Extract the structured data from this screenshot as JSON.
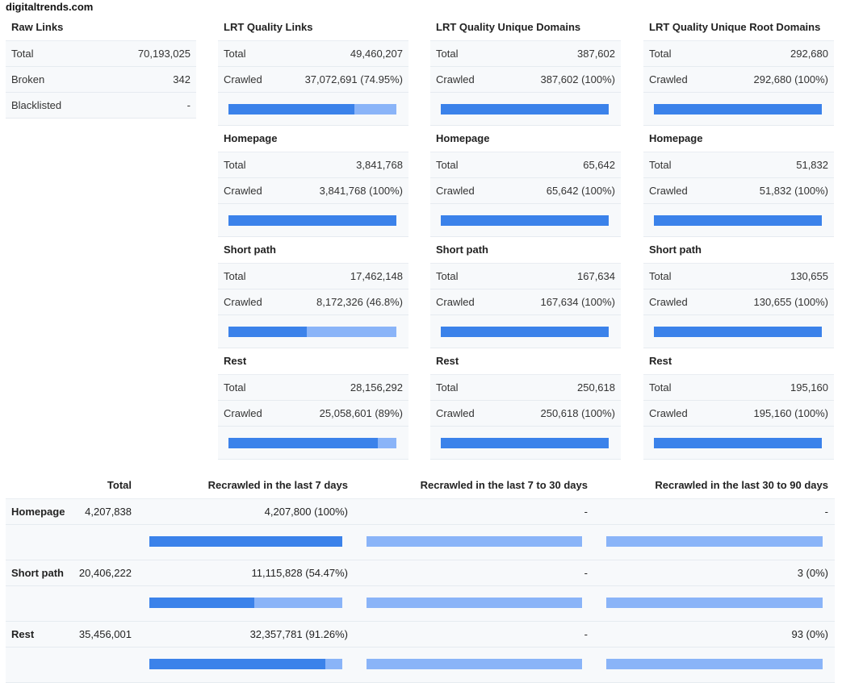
{
  "site": "digitaltrends.com",
  "raw_links": {
    "title": "Raw Links",
    "rows": [
      {
        "label": "Total",
        "value": "70,193,025"
      },
      {
        "label": "Broken",
        "value": "342"
      },
      {
        "label": "Blacklisted",
        "value": "-"
      }
    ]
  },
  "columns": [
    {
      "title": "LRT Quality Links",
      "sections": [
        {
          "title": "",
          "total_label": "Total",
          "total": "49,460,207",
          "crawled_label": "Crawled",
          "crawled": "37,072,691 (74.95%)",
          "fraction": 0.7495
        },
        {
          "title": "Homepage",
          "total_label": "Total",
          "total": "3,841,768",
          "crawled_label": "Crawled",
          "crawled": "3,841,768 (100%)",
          "fraction": 1.0
        },
        {
          "title": "Short path",
          "total_label": "Total",
          "total": "17,462,148",
          "crawled_label": "Crawled",
          "crawled": "8,172,326 (46.8%)",
          "fraction": 0.468
        },
        {
          "title": "Rest",
          "total_label": "Total",
          "total": "28,156,292",
          "crawled_label": "Crawled",
          "crawled": "25,058,601 (89%)",
          "fraction": 0.89
        }
      ]
    },
    {
      "title": "LRT Quality Unique Domains",
      "sections": [
        {
          "title": "",
          "total_label": "Total",
          "total": "387,602",
          "crawled_label": "Crawled",
          "crawled": "387,602 (100%)",
          "fraction": 1.0
        },
        {
          "title": "Homepage",
          "total_label": "Total",
          "total": "65,642",
          "crawled_label": "Crawled",
          "crawled": "65,642 (100%)",
          "fraction": 1.0
        },
        {
          "title": "Short path",
          "total_label": "Total",
          "total": "167,634",
          "crawled_label": "Crawled",
          "crawled": "167,634 (100%)",
          "fraction": 1.0
        },
        {
          "title": "Rest",
          "total_label": "Total",
          "total": "250,618",
          "crawled_label": "Crawled",
          "crawled": "250,618 (100%)",
          "fraction": 1.0
        }
      ]
    },
    {
      "title": "LRT Quality Unique Root Domains",
      "sections": [
        {
          "title": "",
          "total_label": "Total",
          "total": "292,680",
          "crawled_label": "Crawled",
          "crawled": "292,680 (100%)",
          "fraction": 1.0
        },
        {
          "title": "Homepage",
          "total_label": "Total",
          "total": "51,832",
          "crawled_label": "Crawled",
          "crawled": "51,832 (100%)",
          "fraction": 1.0
        },
        {
          "title": "Short path",
          "total_label": "Total",
          "total": "130,655",
          "crawled_label": "Crawled",
          "crawled": "130,655 (100%)",
          "fraction": 1.0
        },
        {
          "title": "Rest",
          "total_label": "Total",
          "total": "195,160",
          "crawled_label": "Crawled",
          "crawled": "195,160 (100%)",
          "fraction": 1.0
        }
      ]
    }
  ],
  "recrawl": {
    "headers": {
      "total": "Total",
      "last7": "Recrawled in the last 7 days",
      "last7to30": "Recrawled in the last 7 to 30 days",
      "last30to90": "Recrawled in the last 30 to 90 days"
    },
    "rows": [
      {
        "label": "Homepage",
        "total": "4,207,838",
        "last7": "4,207,800 (100%)",
        "last7to30": "-",
        "last30to90": "-",
        "f7": 1.0,
        "f7to30": 0,
        "f30to90": 0
      },
      {
        "label": "Short path",
        "total": "20,406,222",
        "last7": "11,115,828 (54.47%)",
        "last7to30": "-",
        "last30to90": "3 (0%)",
        "f7": 0.5447,
        "f7to30": 0,
        "f30to90": 0
      },
      {
        "label": "Rest",
        "total": "35,456,001",
        "last7": "32,357,781 (91.26%)",
        "last7to30": "-",
        "last30to90": "93 (0%)",
        "f7": 0.9126,
        "f7to30": 0,
        "f30to90": 0
      }
    ]
  },
  "colors": {
    "bar_fill": "#3b82ea",
    "bar_track": "#8ab4f8",
    "row_bg": "#f7f9fb"
  }
}
